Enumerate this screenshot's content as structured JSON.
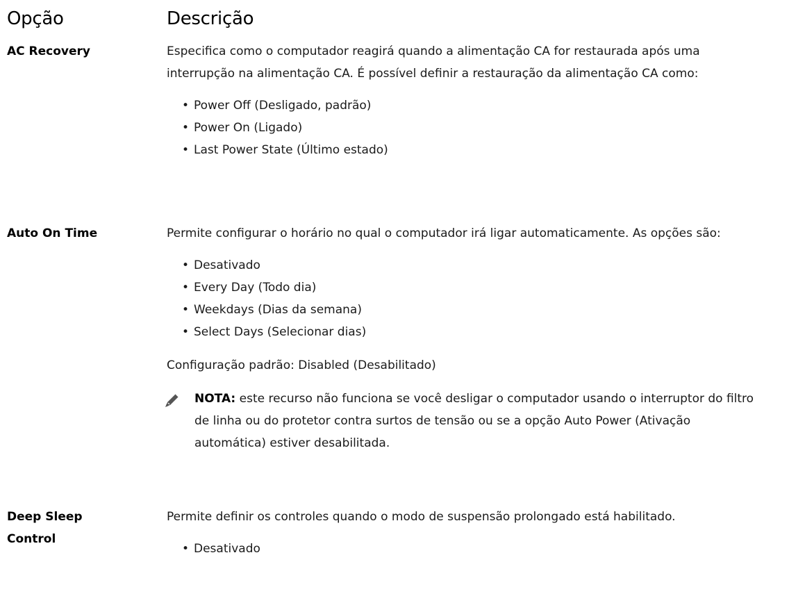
{
  "header": {
    "option": "Opção",
    "description": "Descrição"
  },
  "rows": [
    {
      "option": "AC Recovery",
      "intro": "Especifica como o computador reagirá quando a alimentação CA for restaurada após uma interrupção na alimentação CA. É possível definir a restauração da alimentação CA como:",
      "items": [
        "Power Off (Desligado, padrão)",
        "Power On (Ligado)",
        "Last Power State (Último estado)"
      ]
    },
    {
      "option": "Auto On Time",
      "intro": "Permite configurar o horário no qual o computador irá ligar automaticamente. As opções são:",
      "items": [
        "Desativado",
        "Every Day (Todo dia)",
        "Weekdays (Dias da semana)",
        "Select Days (Selecionar dias)"
      ],
      "default": "Configuração padrão: Disabled (Desabilitado)",
      "note_label": "NOTA:",
      "note_text": "este recurso não funciona se você desligar o computador usando o interruptor do filtro de linha ou do protetor contra surtos de tensão ou se a opção Auto Power (Ativação automática) estiver desabilitada.",
      "note_icon": "pencil-icon"
    },
    {
      "option": "Deep Sleep Control",
      "intro": "Permite definir os controles quando o modo de suspensão prolongado está habilitado.",
      "items": [
        "Desativado"
      ]
    }
  ]
}
